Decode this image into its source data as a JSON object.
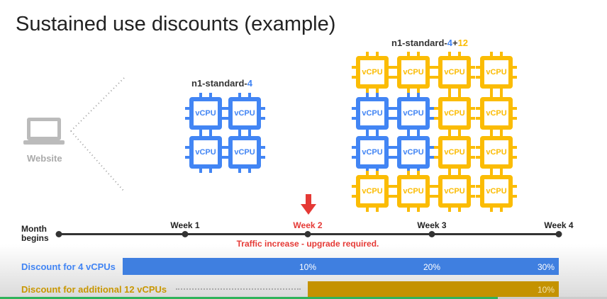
{
  "title": "Sustained use discounts (example)",
  "website_label": "Website",
  "chip_label": "vCPU",
  "machine_small": {
    "prefix": "n1-standard-",
    "n": "4"
  },
  "machine_large": {
    "prefix": "n1-standard-",
    "n": "4",
    "plus": "+",
    "extra": "12"
  },
  "timeline": {
    "start": "Month begins",
    "weeks": [
      "Week 1",
      "Week 2",
      "Week 3",
      "Week 4"
    ],
    "note": "Traffic increase - upgrade required."
  },
  "discounts": [
    {
      "label": "Discount for 4 vCPUs",
      "values": [
        "10%",
        "20%",
        "30%"
      ]
    },
    {
      "label": "Discount for additional 12 vCPUs",
      "values": [
        "10%"
      ]
    }
  ],
  "colors": {
    "blue": "#4285f4",
    "yellow": "#fbbc04",
    "red": "#e53935",
    "gold": "#c99700"
  },
  "video_progress": 0.82
}
